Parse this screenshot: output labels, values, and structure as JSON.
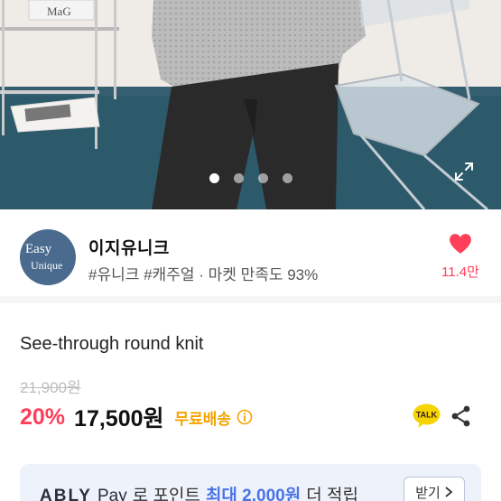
{
  "hero": {
    "photo_sign_text": "MaG",
    "pager": {
      "total": 4,
      "active": 0
    },
    "icons": {
      "expand": "expand-icon"
    }
  },
  "seller": {
    "name": "이지유니크",
    "tags": "#유니크 #캐주얼 · 마켓 만족도 93%",
    "logo_text_line1": "Easy",
    "logo_text_line2": "Unique",
    "likes": "11.4만",
    "icons": {
      "like": "heart-icon"
    }
  },
  "product": {
    "name": "See-through round knit",
    "original_price": "21,900원",
    "discount": "20%",
    "price": "17,500원",
    "shipping": "무료배송",
    "icons": {
      "info": "info-icon",
      "talk": "kakao-talk-icon",
      "share": "share-icon"
    }
  },
  "banner": {
    "logo": "ABLY",
    "pay": "Pay",
    "text1": "로 포인트",
    "highlight": "최대 2,000원",
    "text2": "더 적립",
    "button": "받기",
    "icons": {
      "chevron": "chevron-right-icon"
    }
  },
  "colors": {
    "accent_pink": "#ff3f5a",
    "shipping_yellow": "#f5a300",
    "pay_blue": "#4a73e8",
    "banner_bg": "#eef2fb"
  }
}
